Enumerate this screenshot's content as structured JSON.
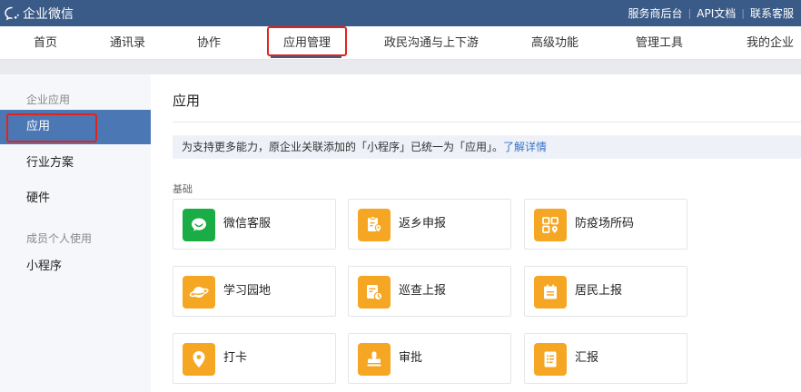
{
  "brand": {
    "name": "企业微信"
  },
  "toplinks": [
    "服务商后台",
    "API文档",
    "联系客服"
  ],
  "nav": {
    "items": [
      "首页",
      "通讯录",
      "协作",
      "应用管理",
      "政民沟通与上下游",
      "高级功能",
      "管理工具",
      "我的企业"
    ],
    "active": "应用管理"
  },
  "sidebar": {
    "group1": "企业应用",
    "items1": [
      "应用",
      "行业方案",
      "硬件"
    ],
    "group2": "成员个人使用",
    "items2": [
      "小程序"
    ],
    "active": "应用"
  },
  "main": {
    "title": "应用",
    "notice_text": "为支持更多能力，原企业关联添加的「小程序」已统一为「应用」。",
    "notice_link": "了解详情",
    "section_label": "基础",
    "apps": [
      {
        "label": "微信客服",
        "icon": "wechat-service-icon",
        "color": "#1aad45"
      },
      {
        "label": "返乡申报",
        "icon": "clipboard-location-icon",
        "color": "#f5a623"
      },
      {
        "label": "防疫场所码",
        "icon": "qr-location-icon",
        "color": "#f5a623"
      },
      {
        "label": "学习园地",
        "icon": "planet-icon",
        "color": "#f5a623"
      },
      {
        "label": "巡查上报",
        "icon": "document-clock-icon",
        "color": "#f5a623"
      },
      {
        "label": "居民上报",
        "icon": "calendar-report-icon",
        "color": "#f5a623"
      },
      {
        "label": "打卡",
        "icon": "location-pin-icon",
        "color": "#f5a623"
      },
      {
        "label": "审批",
        "icon": "stamp-icon",
        "color": "#f5a623"
      },
      {
        "label": "汇报",
        "icon": "report-list-icon",
        "color": "#f5a623"
      }
    ]
  },
  "colors": {
    "header": "#3a5a87",
    "sidebar_active": "#4b78b5",
    "highlight_box": "#e2231a",
    "link": "#3a73c4"
  }
}
